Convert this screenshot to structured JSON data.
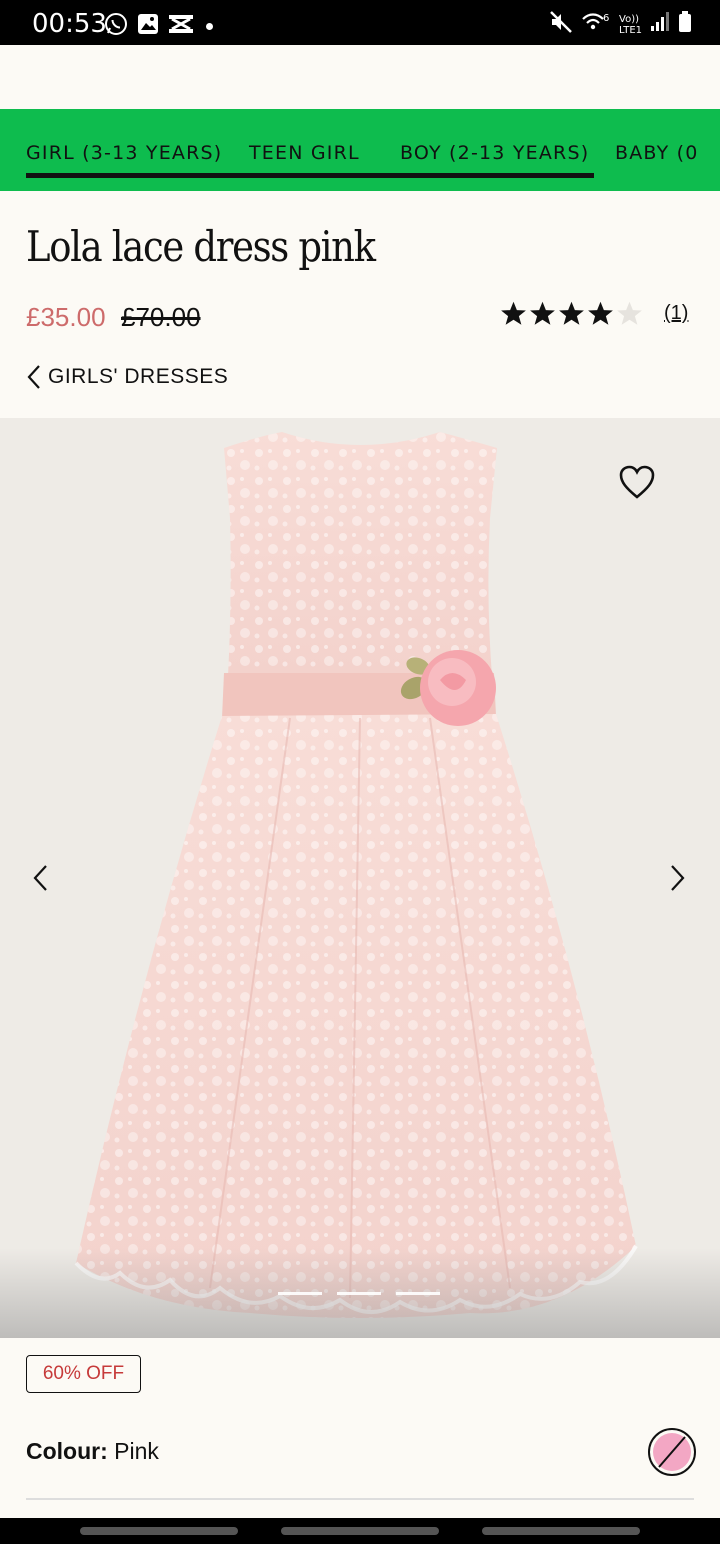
{
  "status_bar": {
    "time": "00:53",
    "left_icons": [
      "whatsapp-icon",
      "gallery-icon",
      "cross-app-icon",
      "dot-icon"
    ],
    "right_icons": [
      "mute-icon",
      "wifi-icon",
      "volte-icon",
      "signal-icon",
      "battery-icon"
    ],
    "volte_label": "Vo))",
    "lte_label": "LTE1",
    "wifi_label": "6"
  },
  "category_nav": {
    "tabs": [
      {
        "label": "GIRL (3-13 YEARS)",
        "active": true
      },
      {
        "label": "TEEN GIRL",
        "active": false
      },
      {
        "label": "BOY (2-13 YEARS)",
        "active": false
      },
      {
        "label": "BABY (0",
        "active": false
      }
    ]
  },
  "product": {
    "title": "Lola lace dress pink",
    "sale_price": "£35.00",
    "original_price": "£70.00",
    "rating": 4,
    "rating_max": 5,
    "review_count": "(1)",
    "breadcrumb": "GIRLS' DRESSES",
    "discount_badge": "60% OFF",
    "colour_label": "Colour:",
    "colour_value": "Pink"
  },
  "gallery": {
    "slide_count": 3,
    "active_slide": 1
  },
  "colors": {
    "nav_green": "#0ebc4e",
    "sale_red": "#cd6b6b",
    "badge_red": "#c63a3a",
    "swatch_pink": "#f3a7c4",
    "page_bg": "#fcfaf5"
  }
}
